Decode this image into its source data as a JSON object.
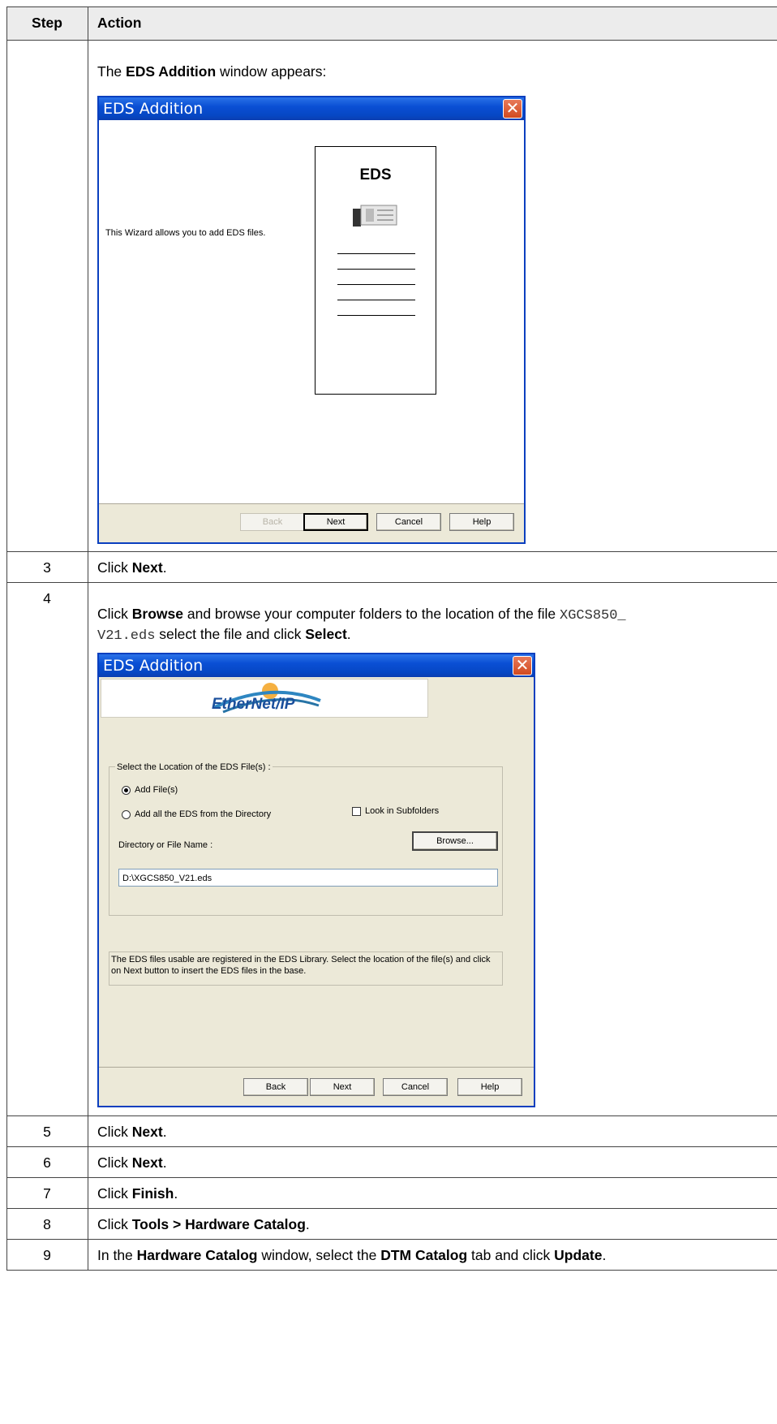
{
  "table": {
    "header_step": "Step",
    "header_action": "Action"
  },
  "row_window1": {
    "intro_prefix": "The ",
    "intro_bold": "EDS Addition",
    "intro_suffix": " window appears:",
    "window": {
      "title": "EDS Addition",
      "close_glyph": "✕",
      "wizard_text": "This Wizard allows you to add EDS files.",
      "graphic_heading": "EDS",
      "buttons": {
        "back": "Back",
        "next": "Next",
        "cancel": "Cancel",
        "help": "Help"
      }
    }
  },
  "row3": {
    "step": "3",
    "prefix": "Click ",
    "bold": "Next",
    "suffix": "."
  },
  "row4": {
    "step": "4",
    "t1": "Click ",
    "b1": "Browse",
    "t2": " and browse your computer folders to the location of the file ",
    "code1": "XGCS850_",
    "code2": "V21.eds",
    "t3": " select the file and click ",
    "b2": "Select",
    "t4": ".",
    "window": {
      "title": "EDS Addition",
      "close_glyph": "✕",
      "logo_text": "EtherNet/IP",
      "group_label": "Select the Location of the EDS File(s) :",
      "radio_add_files": "Add File(s)",
      "radio_add_dir": "Add all the EDS from the Directory",
      "checkbox_subfolders": "Look in Subfolders",
      "dir_label": "Directory or File Name :",
      "browse_button": "Browse...",
      "path_value": "D:\\XGCS850_V21.eds",
      "info_text": "The EDS files usable are registered in the EDS Library. Select the location of the file(s) and click on Next button to insert the EDS files in the base.",
      "buttons": {
        "back": "Back",
        "next": "Next",
        "cancel": "Cancel",
        "help": "Help"
      }
    }
  },
  "row5": {
    "step": "5",
    "prefix": "Click ",
    "bold": "Next",
    "suffix": "."
  },
  "row6": {
    "step": "6",
    "prefix": "Click ",
    "bold": "Next",
    "suffix": "."
  },
  "row7": {
    "step": "7",
    "prefix": "Click ",
    "bold": "Finish",
    "suffix": "."
  },
  "row8": {
    "step": "8",
    "prefix": "Click ",
    "bold1": "Tools",
    "sep": " > ",
    "bold2": "Hardware Catalog",
    "suffix": "."
  },
  "row9": {
    "step": "9",
    "t1": "In the ",
    "b1": "Hardware Catalog",
    "t2": " window, select the ",
    "b2": "DTM Catalog",
    "t3": " tab and click ",
    "b3": "Update",
    "t4": "."
  }
}
